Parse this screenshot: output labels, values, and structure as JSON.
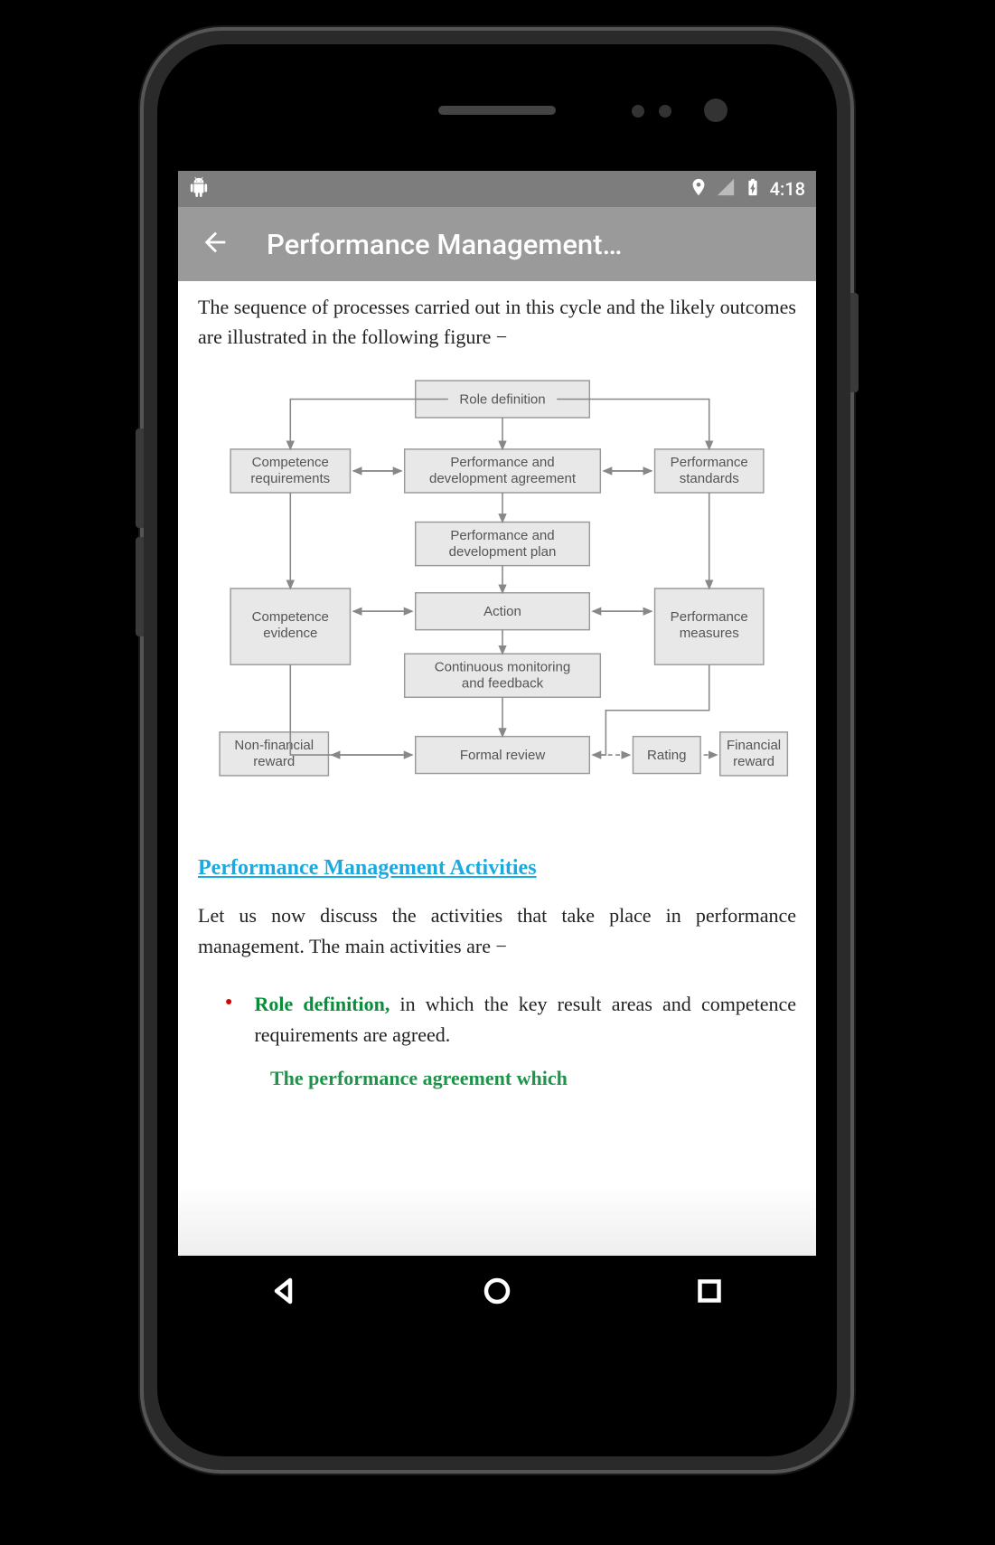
{
  "status_bar": {
    "time": "4:18"
  },
  "app_bar": {
    "title": "Performance Management…"
  },
  "content": {
    "intro": "The sequence of processes carried out in this cycle and the likely outcomes are illustrated in the following figure −",
    "section_heading": "Performance Management Activities",
    "body": "Let us now discuss the activities that take place in performance management. The main activities are −",
    "bullet1_term": "Role definition,",
    "bullet1_text": " in which the key result areas and competence requirements are agreed.",
    "partial": "The performance agreement which"
  },
  "chart_data": {
    "type": "diagram",
    "nodes": [
      {
        "id": "role_def",
        "label": "Role definition"
      },
      {
        "id": "comp_req",
        "label": "Competence requirements"
      },
      {
        "id": "perf_dev_agr",
        "label": "Performance and development agreement"
      },
      {
        "id": "perf_std",
        "label": "Performance standards"
      },
      {
        "id": "perf_dev_plan",
        "label": "Performance and development plan"
      },
      {
        "id": "action",
        "label": "Action"
      },
      {
        "id": "comp_ev",
        "label": "Competence evidence"
      },
      {
        "id": "perf_meas",
        "label": "Performance measures"
      },
      {
        "id": "cont_mon",
        "label": "Continuous monitoring and feedback"
      },
      {
        "id": "nonfin",
        "label": "Non-financial reward"
      },
      {
        "id": "formal_rev",
        "label": "Formal review"
      },
      {
        "id": "rating",
        "label": "Rating"
      },
      {
        "id": "fin_rew",
        "label": "Financial reward"
      }
    ],
    "edges": [
      {
        "from": "role_def",
        "to": "comp_req"
      },
      {
        "from": "role_def",
        "to": "perf_dev_agr"
      },
      {
        "from": "role_def",
        "to": "perf_std"
      },
      {
        "from": "comp_req",
        "to": "perf_dev_agr",
        "bi": true
      },
      {
        "from": "perf_std",
        "to": "perf_dev_agr",
        "bi": true
      },
      {
        "from": "perf_dev_agr",
        "to": "perf_dev_plan"
      },
      {
        "from": "perf_dev_plan",
        "to": "action"
      },
      {
        "from": "comp_req",
        "to": "comp_ev"
      },
      {
        "from": "perf_std",
        "to": "perf_meas"
      },
      {
        "from": "comp_ev",
        "to": "action",
        "bi": true
      },
      {
        "from": "perf_meas",
        "to": "action",
        "bi": true
      },
      {
        "from": "action",
        "to": "cont_mon"
      },
      {
        "from": "cont_mon",
        "to": "formal_rev"
      },
      {
        "from": "comp_ev",
        "to": "formal_rev"
      },
      {
        "from": "perf_meas",
        "to": "formal_rev"
      },
      {
        "from": "formal_rev",
        "to": "nonfin"
      },
      {
        "from": "formal_rev",
        "to": "rating",
        "dashed": true
      },
      {
        "from": "rating",
        "to": "fin_rew",
        "dashed": true
      }
    ]
  }
}
